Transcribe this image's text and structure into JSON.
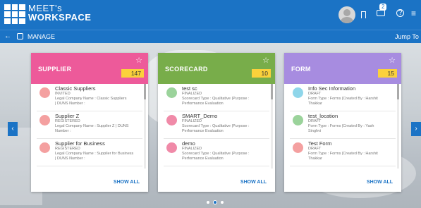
{
  "header": {
    "brand_line1": "MEET's",
    "brand_line2": "WORKSPACE",
    "notification_count": "2",
    "help_glyph": "?",
    "menu_glyph": "≡"
  },
  "subheader": {
    "back_glyph": "←",
    "section": "MANAGE",
    "jump_to": "Jump To"
  },
  "nav": {
    "prev_glyph": "‹",
    "next_glyph": "›"
  },
  "colors": {
    "primary": "#1b73c5",
    "supplier": "#ed5a9a",
    "scorecard": "#78ad4a",
    "form": "#a78ce0",
    "count_badge": "#fbd13b"
  },
  "cards": [
    {
      "title": "SUPPLIER",
      "count": "147",
      "star": "☆",
      "show_all": "SHOW ALL",
      "items": [
        {
          "title": "Classic Suppliers",
          "status": "INVITED",
          "desc1": "Legal Company Name : Classic Suppliers",
          "desc2": "| DUNS Number :"
        },
        {
          "title": "Supplier Z",
          "status": "REGISTERED",
          "desc1": "Legal Company Name : Supplier Z | DUNS",
          "desc2": "Number :"
        },
        {
          "title": "Supplier for Business",
          "status": "REGISTERED",
          "desc1": "Legal Company Name : Supplier for Business",
          "desc2": "| DUNS Number :"
        }
      ]
    },
    {
      "title": "SCORECARD",
      "count": "10",
      "star": "☆",
      "show_all": "SHOW ALL",
      "items": [
        {
          "title": "test sc",
          "status": "FINALIZED",
          "desc1": "Scorecard Type : Qualitative |Purpose :",
          "desc2": "Performance Evaluation"
        },
        {
          "title": "SMART_Demo",
          "status": "FINALIZED",
          "desc1": "Scorecard Type : Qualitative |Purpose :",
          "desc2": "Performance Evaluation"
        },
        {
          "title": "demo",
          "status": "FINALIZED",
          "desc1": "Scorecard Type : Qualitative |Purpose :",
          "desc2": "Performance Evaluation"
        }
      ]
    },
    {
      "title": "FORM",
      "count": "15",
      "star": "☆",
      "show_all": "SHOW ALL",
      "items": [
        {
          "title": "Info Sec Information",
          "status": "DRAFT",
          "desc1": "Form Type : Forms |Created By : Harshit",
          "desc2": "Thakkar"
        },
        {
          "title": "test_location",
          "status": "DRAFT",
          "desc1": "Form Type : Forms |Created By : Yash",
          "desc2": "Singhvi"
        },
        {
          "title": "Test Form",
          "status": "DRAFT",
          "desc1": "Form Type : Forms |Created By : Harshit",
          "desc2": "Thakkar"
        }
      ]
    }
  ]
}
